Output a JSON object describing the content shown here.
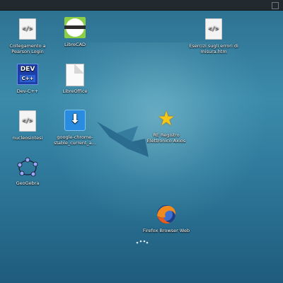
{
  "desktop": {
    "icons": [
      {
        "label": "Collegamento a Pearson Login",
        "icon": "html-file-icon"
      },
      {
        "label": "LibreCAD",
        "icon": "librecad-icon"
      },
      {
        "label": "Esercizi sugli errori di misura.htm",
        "icon": "html-file-icon"
      },
      {
        "label": "Dev-C++",
        "icon": "devcpp-icon"
      },
      {
        "label": "LibreOffice",
        "icon": "libreoffice-icon"
      },
      {
        "label": "nucleosintesi",
        "icon": "html-file-icon"
      },
      {
        "label": "google-chrome-stable_current_a...",
        "icon": "download-icon"
      },
      {
        "label": "RE Registro Elettronico Axios",
        "icon": "star-icon"
      },
      {
        "label": "GeoGebra",
        "icon": "geogebra-icon"
      },
      {
        "label": "Firefox Browser Web",
        "icon": "firefox-icon"
      }
    ],
    "glyphs": {
      "html": "</>",
      "dev": "DEV",
      "cpp": "C++",
      "download": "⬇",
      "star": "★"
    }
  }
}
